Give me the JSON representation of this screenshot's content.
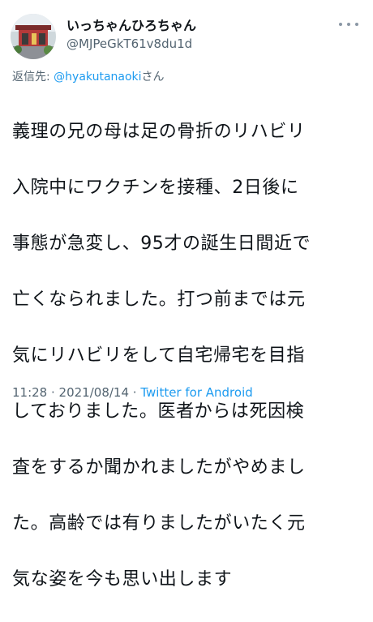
{
  "author": {
    "display_name": "いっちゃんひろちゃん",
    "handle": "@MJPeGkT61v8du1d",
    "avatar_icon": "avatar-photo-icon"
  },
  "more_icon": "more-horizontal-icon",
  "reply": {
    "prefix": "返信先: ",
    "mention": "@hyakutanaoki",
    "suffix": "さん"
  },
  "tweet": {
    "text_lines": [
      "義理の兄の母は足の骨折のリハビリ",
      "入院中にワクチンを接種、2日後に",
      "事態が急変し、95才の誕生日間近で",
      "亡くなられました。打つ前までは元",
      "気にリハビリをして自宅帰宅を目指",
      "しておりました。医者からは死因検",
      "査をするか聞かれましたがやめまし",
      "た。高齢では有りましたがいたく元",
      "気な姿を今も思い出します"
    ]
  },
  "meta": {
    "time": "11:28",
    "separator": " · ",
    "date": "2021/08/14",
    "source": "Twitter for Android"
  },
  "colors": {
    "text": "#0f1419",
    "secondary": "#536471",
    "link": "#1d9bf0"
  }
}
